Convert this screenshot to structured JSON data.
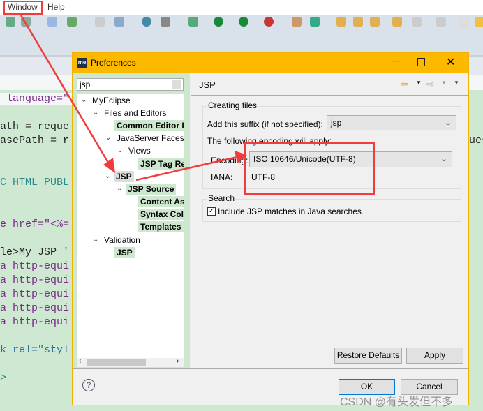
{
  "menubar": {
    "items": [
      "Window",
      "Help"
    ]
  },
  "editor": {
    "lines": [
      " language=\"",
      "ath = reque",
      "asePath = r",
      "C HTML PUBL",
      "e href=\"<%=",
      "le>My JSP '",
      "a http-equi",
      "a http-equi",
      "a http-equi",
      "a http-equi",
      "a http-equi",
      "k rel=\"styl",
      ">"
    ],
    "right_fragment": "ues"
  },
  "dialog": {
    "title": "Preferences",
    "logo": "me",
    "filter_value": "jsp",
    "tree": [
      "MyEclipse",
      "Files and Editors",
      "Common Editor I",
      "JavaServer Faces T",
      "Views",
      "JSP Tag Re",
      "JSP",
      "JSP Source",
      "Content As",
      "Syntax Col",
      "Templates",
      "Validation",
      "JSP"
    ],
    "page_title": "JSP",
    "creating_files": {
      "label": "Creating files",
      "suffix_label": "Add this suffix (if not specified):",
      "suffix_value": "jsp",
      "encoding_note": "The following encoding will apply:",
      "encoding_label": "Encoding:",
      "encoding_value": "ISO 10646/Unicode(UTF-8)",
      "iana_label": "IANA:",
      "iana_value": "UTF-8"
    },
    "search": {
      "label": "Search",
      "checkbox_label": "Include JSP matches in Java searches",
      "checked": true
    },
    "buttons": {
      "restore": "Restore Defaults",
      "apply": "Apply",
      "ok": "OK",
      "cancel": "Cancel"
    }
  },
  "watermark": "CSDN @有头发但不多",
  "colors": {
    "title_bar": "#fdb900",
    "highlight": "#cde8cf",
    "annotation": "#f03c3c"
  }
}
